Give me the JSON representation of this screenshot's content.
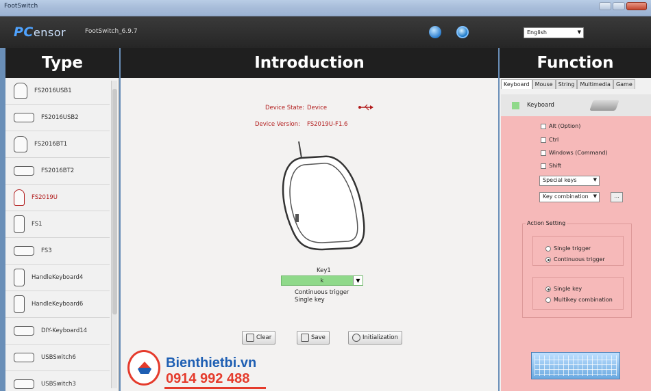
{
  "window": {
    "title": "FootSwitch"
  },
  "header": {
    "logo_prefix": "PC",
    "logo_rest": "ensor",
    "app_version": "FootSwitch_6.9.7",
    "language": "English"
  },
  "sections": {
    "type": "Type",
    "introduction": "Introduction",
    "function": "Function"
  },
  "type_list": [
    {
      "label": "FS2016USB1"
    },
    {
      "label": "FS2016USB2"
    },
    {
      "label": "FS2016BT1"
    },
    {
      "label": "FS2016BT2"
    },
    {
      "label": "FS2019U"
    },
    {
      "label": "FS1"
    },
    {
      "label": "FS3"
    },
    {
      "label": "HandleKeyboard4"
    },
    {
      "label": "HandleKeyboard6"
    },
    {
      "label": "DIY-Keyboard14"
    },
    {
      "label": "USBSwitch6"
    },
    {
      "label": "USBSwitch3"
    }
  ],
  "device": {
    "state_label": "Device State:",
    "state_value": "Device",
    "version_label": "Device Version:",
    "version_value": "FS2019U-F1.6"
  },
  "key": {
    "label": "Key1",
    "value": "k",
    "trigger_mode": "Continuous trigger",
    "key_mode": "Single key"
  },
  "buttons": {
    "clear": "Clear",
    "save": "Save",
    "init": "Initialization"
  },
  "function": {
    "tabs": [
      "Keyboard",
      "Mouse",
      "String",
      "Multimedia",
      "Game"
    ],
    "mode_label": "Keyboard",
    "modifiers": [
      "Alt (Option)",
      "Ctrl",
      "Windows (Command)",
      "Shift"
    ],
    "special_keys": "Special keys",
    "key_combination": "Key combination",
    "more_btn": "...",
    "action_setting": "Action Setting",
    "trigger_options": [
      "Single trigger",
      "Continuous trigger"
    ],
    "key_options": [
      "Single key",
      "Multikey combination"
    ]
  },
  "watermark": {
    "site": "Bienthietbi.vn",
    "phone": "0914 992 488"
  }
}
